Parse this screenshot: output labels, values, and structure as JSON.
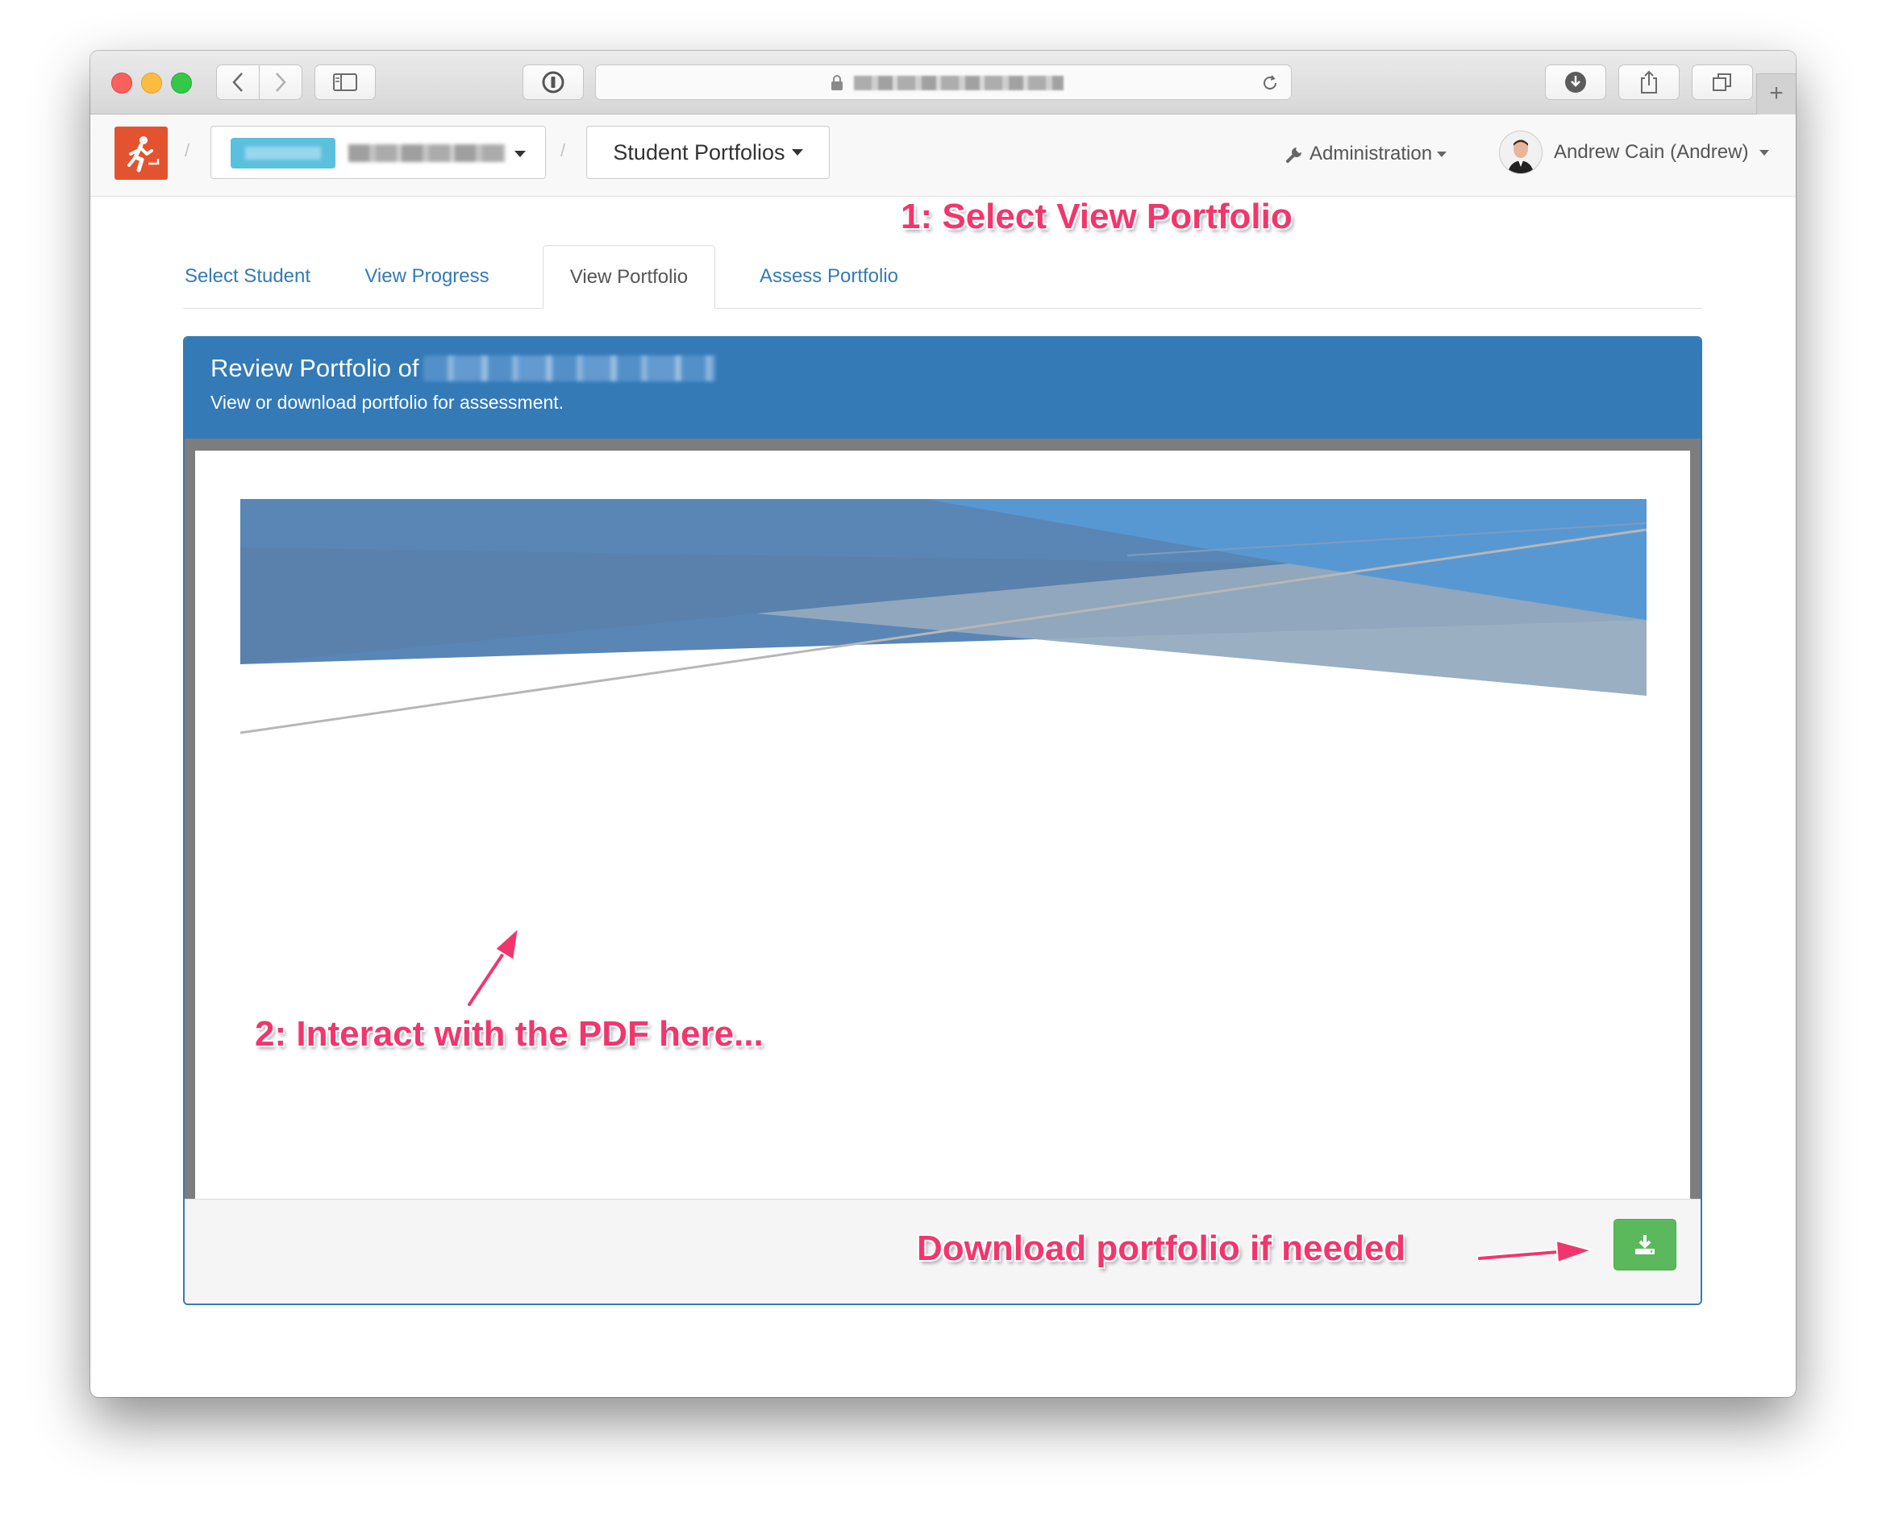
{
  "browser": {
    "address_url": "",
    "new_tab_symbol": "+"
  },
  "navbar": {
    "unit_selector_label": "",
    "section_dropdown_label": "Student Portfolios",
    "admin_label": "Administration",
    "user_name": "Andrew Cain (Andrew)"
  },
  "tabs": [
    {
      "label": "Select Student",
      "active": false
    },
    {
      "label": "View Progress",
      "active": false
    },
    {
      "label": "View Portfolio",
      "active": true
    },
    {
      "label": "Assess Portfolio",
      "active": false
    }
  ],
  "panel": {
    "title": "Review Portfolio of",
    "subtitle": "View or download portfolio for assessment."
  },
  "annotations": {
    "step1": "1: Select View Portfolio",
    "step2": "2: Interact with the PDF here...",
    "step3": "Download portfolio if needed"
  },
  "colors": {
    "primary": "#337ab7",
    "success": "#5cb85c",
    "annotation": "#f2366d",
    "logo": "#e4532f"
  },
  "icons": {
    "download_button": "download-icon",
    "admin": "wrench-icon",
    "logo": "runner-icon"
  }
}
